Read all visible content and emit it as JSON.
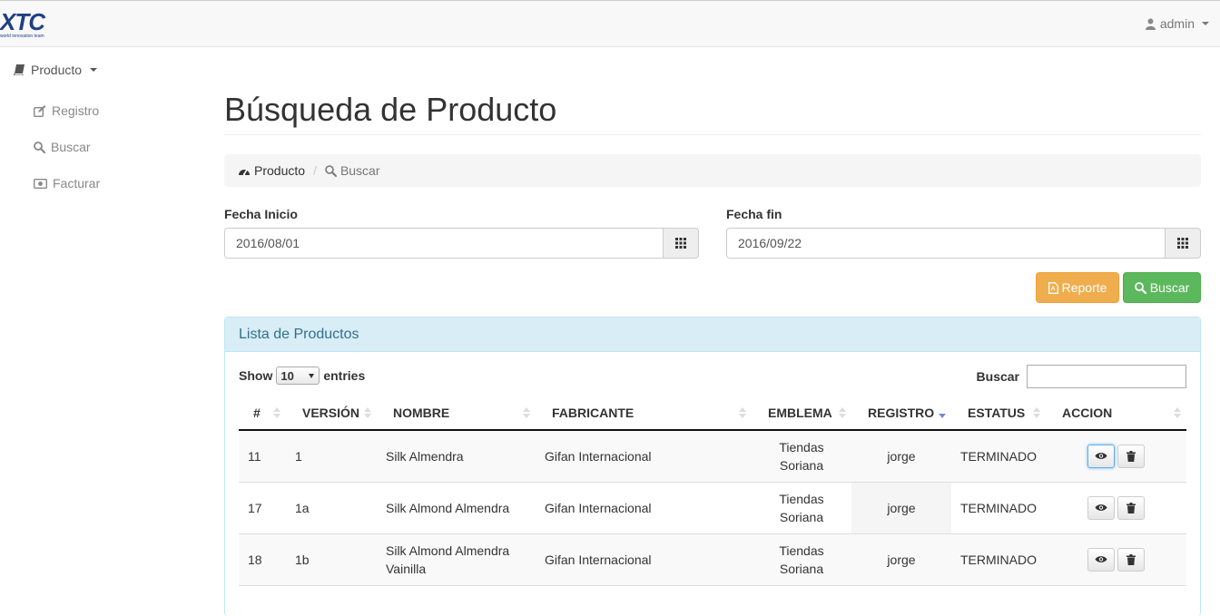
{
  "brand": {
    "logo_text": "XTC",
    "logo_sub": "world innovation team"
  },
  "user_menu": {
    "label": "admin"
  },
  "sidebar": {
    "section_label": "Producto",
    "items": [
      {
        "label": "Registro",
        "icon": "edit-icon"
      },
      {
        "label": "Buscar",
        "icon": "search-icon"
      },
      {
        "label": "Facturar",
        "icon": "money-icon"
      }
    ]
  },
  "page": {
    "title": "Búsqueda de Producto"
  },
  "breadcrumb": {
    "item1": "Producto",
    "item2": "Buscar"
  },
  "filters": {
    "start_label": "Fecha Inicio",
    "start_value": "2016/08/01",
    "end_label": "Fecha fin",
    "end_value": "2016/09/22"
  },
  "buttons": {
    "report": "Reporte",
    "search": "Buscar"
  },
  "panel": {
    "title": "Lista de Productos",
    "show_label": "Show",
    "page_size": "10",
    "entries_label": "entries",
    "search_label": "Buscar"
  },
  "table": {
    "headers": [
      "#",
      "VERSIÓN",
      "NOMBRE",
      "FABRICANTE",
      "EMBLEMA",
      "REGISTRO",
      "ESTATUS",
      "ACCION"
    ],
    "sorted_column": "REGISTRO",
    "rows": [
      {
        "id": "11",
        "version": "1",
        "nombre": "Silk Almendra",
        "fabricante": "Gifan Internacional",
        "emblema_1": "Tiendas",
        "emblema_2": "Soriana",
        "registro": "jorge",
        "estatus": "TERMINADO"
      },
      {
        "id": "17",
        "version": "1a",
        "nombre": "Silk Almond Almendra",
        "fabricante": "Gifan Internacional",
        "emblema_1": "Tiendas",
        "emblema_2": "Soriana",
        "registro": "jorge",
        "estatus": "TERMINADO"
      },
      {
        "id": "18",
        "version": "1b",
        "nombre_1": "Silk Almond Almendra",
        "nombre_2": "Vainilla",
        "fabricante": "Gifan Internacional",
        "emblema_1": "Tiendas",
        "emblema_2": "Soriana",
        "registro": "jorge",
        "estatus": "TERMINADO"
      }
    ]
  },
  "colors": {
    "primary_heading": "#31708f",
    "warning": "#f0ad4e",
    "success": "#5cb85c",
    "brand": "#1f3f86"
  }
}
